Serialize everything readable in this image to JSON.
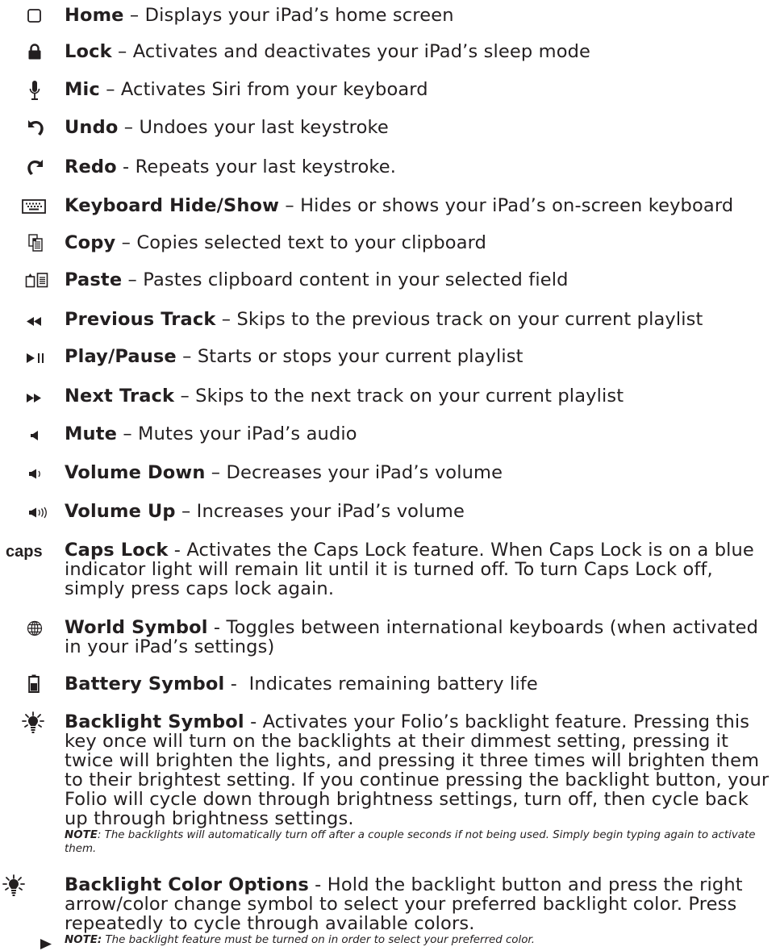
{
  "items": [
    {
      "icon": "home-square-icon",
      "name": "Home",
      "sep": " – ",
      "desc": "Displays your iPad’s home screen"
    },
    {
      "icon": "lock-icon",
      "name": "Lock",
      "sep": " – ",
      "desc": "Activates and deactivates your iPad’s sleep mode"
    },
    {
      "icon": "mic-icon",
      "name": "Mic",
      "sep": " – ",
      "desc": "Activates Siri from your keyboard"
    },
    {
      "icon": "undo-icon",
      "name": "Undo",
      "sep": " – ",
      "desc": "Undoes your last keystroke"
    },
    {
      "icon": "redo-icon",
      "name": "Redo",
      "sep": " - ",
      "desc": "Repeats your last keystroke."
    },
    {
      "icon": "keyboard-icon",
      "name": "Keyboard Hide/Show",
      "sep": " – ",
      "desc": "Hides or shows your iPad’s on-screen keyboard"
    },
    {
      "icon": "copy-icon",
      "name": "Copy",
      "sep": " – ",
      "desc": "Copies selected text to your clipboard"
    },
    {
      "icon": "paste-icon",
      "name": "Paste",
      "sep": " – ",
      "desc": "Pastes clipboard content in your selected field"
    },
    {
      "icon": "previous-track-icon",
      "name": "Previous Track",
      "sep": " – ",
      "desc": "Skips to the previous track on your current playlist"
    },
    {
      "icon": "play-pause-icon",
      "name": "Play/Pause",
      "sep": " – ",
      "desc": "Starts or stops your current playlist"
    },
    {
      "icon": "next-track-icon",
      "name": "Next Track",
      "sep": " – ",
      "desc": "Skips to the next track on your current playlist"
    },
    {
      "icon": "mute-icon",
      "name": "Mute",
      "sep": " – ",
      "desc": "Mutes your iPad’s audio"
    },
    {
      "icon": "volume-down-icon",
      "name": "Volume Down",
      "sep": " – ",
      "desc": "Decreases your iPad’s volume"
    },
    {
      "icon": "volume-up-icon",
      "name": "Volume Up",
      "sep": " – ",
      "desc": "Increases your iPad’s volume"
    },
    {
      "icon": "caps-icon",
      "icon_text": "caps",
      "name": "Caps Lock",
      "sep": " - ",
      "desc": "Activates the Caps Lock feature. When Caps Lock is on a blue indicator light will remain lit until it is turned off. To turn Caps Lock off, simply press caps lock again."
    },
    {
      "icon": "globe-icon",
      "name": "World Symbol",
      "sep": " - ",
      "desc": "Toggles between international keyboards (when activated in your iPad’s settings)"
    },
    {
      "icon": "battery-icon",
      "name": "Battery Symbol",
      "sep": " -  ",
      "desc": "Indicates remaining battery life"
    },
    {
      "icon": "backlight-icon",
      "name": "Backlight Symbol",
      "sep": " - ",
      "desc": "Activates your Folio’s backlight feature. Pressing this key once will turn on the backlights at their dimmest setting, pressing it twice will brighten the lights, and pressing it three times will brighten them to their brightest setting. If you continue pressing the backlight button, your Folio will cycle down through brightness settings, turn off, then cycle back up through brightness settings.",
      "note_label": "NOTE",
      "note_text": ": The backlights will automatically turn off after a couple seconds if not being used. Simply begin typing again to activate them."
    },
    {
      "icon": "backlight-color-icon",
      "name": "Backlight Color Options",
      "sep": " - ",
      "desc": "Hold the backlight button and press the right arrow/color change symbol to select your preferred backlight color. Press repeatedly to cycle through available colors.",
      "note_label": "NOTE:",
      "note_text": " The backlight feature must be turned on in order to select your preferred color."
    }
  ]
}
